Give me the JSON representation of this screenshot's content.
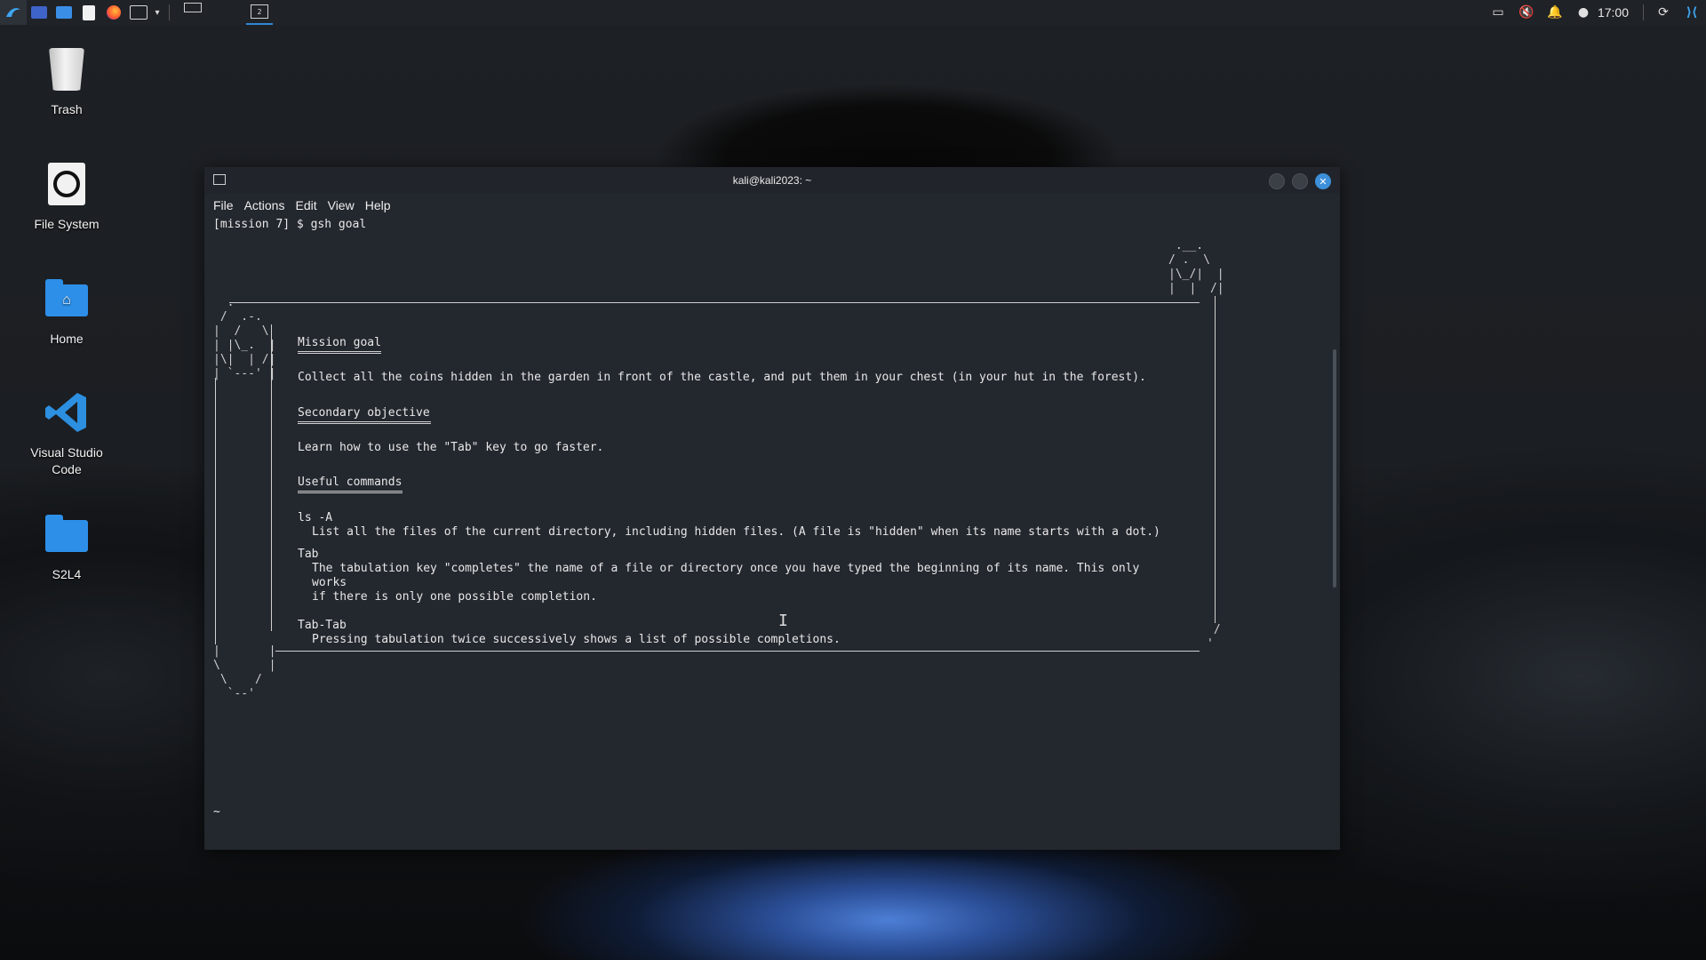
{
  "panel": {
    "clock": "17:00",
    "workspace_badge": "2"
  },
  "desktop": {
    "icons": [
      {
        "label": "Trash"
      },
      {
        "label": "File System"
      },
      {
        "label": "Home"
      },
      {
        "label": "Visual Studio Code"
      },
      {
        "label": "S2L4"
      }
    ]
  },
  "window": {
    "title": "kali@kali2023: ~",
    "menu": [
      "File",
      "Actions",
      "Edit",
      "View",
      "Help"
    ]
  },
  "terminal": {
    "prompt": "[mission 7] $ gsh goal",
    "mission_goal_heading": "Mission goal",
    "mission_goal_text": "Collect all the coins hidden in the garden in front of the castle, and put them in your chest (in your hut in the forest).",
    "secondary_heading": "Secondary objective",
    "secondary_text": "Learn how to use the \"Tab\" key to go faster.",
    "useful_heading": "Useful commands",
    "cmd1_name": "ls -A",
    "cmd1_desc": "List all the files of the current directory, including hidden files. (A file is \"hidden\" when its name starts with a dot.)",
    "cmd2_name": "Tab",
    "cmd2_desc_1": "The tabulation key \"completes\" the name of a file or directory once you have typed the beginning of its name. This only",
    "cmd2_desc_2": "works",
    "cmd2_desc_3": "if there is only one possible completion.",
    "cmd3_name": "Tab-Tab",
    "cmd3_desc": "Pressing tabulation twice successively shows a list of possible completions.",
    "final_prompt": "~"
  }
}
